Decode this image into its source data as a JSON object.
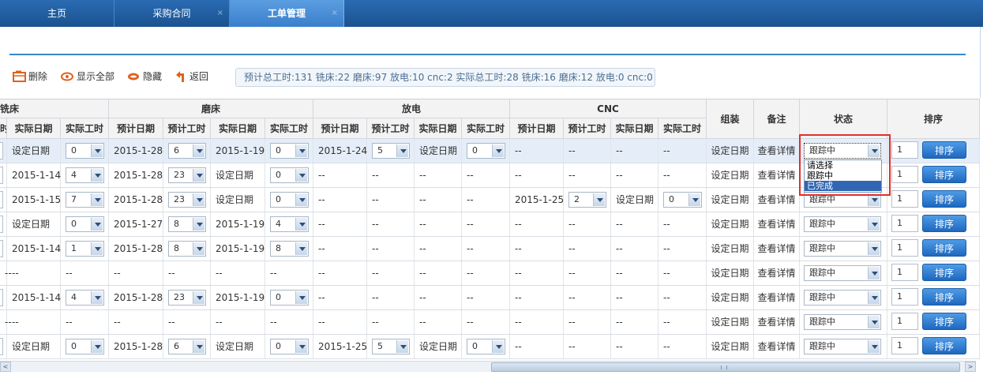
{
  "tabs": [
    {
      "label": "主页",
      "closable": false
    },
    {
      "label": "采购合同",
      "closable": true
    },
    {
      "label": "工单管理",
      "closable": true
    }
  ],
  "close_glyph": "×",
  "toolbar": {
    "delete_label": "删除",
    "show_all_label": "显示全部",
    "hide_label": "隐藏",
    "back_label": "返回",
    "summary": "预计总工时:131 铣床:22 磨床:97 放电:10 cnc:2 实际总工时:28 铣床:16 磨床:12 放电:0 cnc:0"
  },
  "headers": {
    "group_mill": "铣床",
    "group_grind": "磨床",
    "group_edm": "放电",
    "group_cnc": "CNC",
    "assembly": "组装",
    "remark": "备注",
    "status": "状态",
    "sort": "排序",
    "mill_est_hours_cut": "时",
    "actual_date": "实际日期",
    "actual_hours": "实际工时",
    "est_date": "预计日期",
    "est_hours": "预计工时"
  },
  "rows": [
    {
      "c0": "",
      "m_ad": "设定日期",
      "m_ah": "0",
      "g_ed": "2015-1-28",
      "g_eh": "6",
      "g_ad": "2015-1-19",
      "g_ah": "0",
      "e_ed": "2015-1-24",
      "e_eh": "5",
      "e_ad": "设定日期",
      "e_ah": "0",
      "n_ed": "--",
      "n_eh": "--",
      "n_ad": "--",
      "n_ah": "--",
      "assembly": "设定日期",
      "remark": "查看详情",
      "status": "跟踪中",
      "sort": "1",
      "btn": "排序"
    },
    {
      "c0": "",
      "m_ad": "2015-1-14",
      "m_ah": "4",
      "g_ed": "2015-1-28",
      "g_eh": "23",
      "g_ad": "设定日期",
      "g_ah": "0",
      "e_ed": "--",
      "e_eh": "--",
      "e_ad": "--",
      "e_ah": "--",
      "n_ed": "--",
      "n_eh": "--",
      "n_ad": "--",
      "n_ah": "--",
      "assembly": "设定日期",
      "remark": "查看详情",
      "status": "跟踪中",
      "sort": "1",
      "btn": "排序"
    },
    {
      "c0": "",
      "m_ad": "2015-1-15",
      "m_ah": "7",
      "g_ed": "2015-1-28",
      "g_eh": "23",
      "g_ad": "设定日期",
      "g_ah": "0",
      "e_ed": "--",
      "e_eh": "--",
      "e_ad": "--",
      "e_ah": "--",
      "n_ed": "2015-1-25",
      "n_eh": "2",
      "n_ad": "设定日期",
      "n_ah": "0",
      "assembly": "设定日期",
      "remark": "查看详情",
      "status": "跟踪中",
      "sort": "1",
      "btn": "排序"
    },
    {
      "c0": "",
      "m_ad": "设定日期",
      "m_ah": "0",
      "g_ed": "2015-1-27",
      "g_eh": "8",
      "g_ad": "2015-1-19",
      "g_ah": "4",
      "e_ed": "--",
      "e_eh": "--",
      "e_ad": "--",
      "e_ah": "--",
      "n_ed": "--",
      "n_eh": "--",
      "n_ad": "--",
      "n_ah": "--",
      "assembly": "设定日期",
      "remark": "查看详情",
      "status": "跟踪中",
      "sort": "1",
      "btn": "排序"
    },
    {
      "c0": "",
      "m_ad": "2015-1-14",
      "m_ah": "1",
      "g_ed": "2015-1-28",
      "g_eh": "8",
      "g_ad": "2015-1-19",
      "g_ah": "8",
      "e_ed": "--",
      "e_eh": "--",
      "e_ad": "--",
      "e_ah": "--",
      "n_ed": "--",
      "n_eh": "--",
      "n_ad": "--",
      "n_ah": "--",
      "assembly": "设定日期",
      "remark": "查看详情",
      "status": "跟踪中",
      "sort": "1",
      "btn": "排序"
    },
    {
      "c0": "--",
      "m_ad": "--",
      "m_ah": "--",
      "g_ed": "--",
      "g_eh": "--",
      "g_ad": "--",
      "g_ah": "--",
      "e_ed": "--",
      "e_eh": "--",
      "e_ad": "--",
      "e_ah": "--",
      "n_ed": "--",
      "n_eh": "--",
      "n_ad": "--",
      "n_ah": "--",
      "assembly": "设定日期",
      "remark": "查看详情",
      "status": "跟踪中",
      "sort": "1",
      "btn": "排序"
    },
    {
      "c0": "",
      "m_ad": "2015-1-14",
      "m_ah": "4",
      "g_ed": "2015-1-28",
      "g_eh": "23",
      "g_ad": "2015-1-19",
      "g_ah": "0",
      "e_ed": "--",
      "e_eh": "--",
      "e_ad": "--",
      "e_ah": "--",
      "n_ed": "--",
      "n_eh": "--",
      "n_ad": "--",
      "n_ah": "--",
      "assembly": "设定日期",
      "remark": "查看详情",
      "status": "跟踪中",
      "sort": "1",
      "btn": "排序"
    },
    {
      "c0": "--",
      "m_ad": "--",
      "m_ah": "--",
      "g_ed": "--",
      "g_eh": "--",
      "g_ad": "--",
      "g_ah": "--",
      "e_ed": "--",
      "e_eh": "--",
      "e_ad": "--",
      "e_ah": "--",
      "n_ed": "--",
      "n_eh": "--",
      "n_ad": "--",
      "n_ah": "--",
      "assembly": "设定日期",
      "remark": "查看详情",
      "status": "跟踪中",
      "sort": "1",
      "btn": "排序"
    },
    {
      "c0": "",
      "m_ad": "设定日期",
      "m_ah": "0",
      "g_ed": "2015-1-28",
      "g_eh": "6",
      "g_ad": "设定日期",
      "g_ah": "0",
      "e_ed": "2015-1-25",
      "e_eh": "5",
      "e_ad": "设定日期",
      "e_ah": "0",
      "n_ed": "--",
      "n_eh": "--",
      "n_ad": "--",
      "n_ah": "--",
      "assembly": "设定日期",
      "remark": "查看详情",
      "status": "跟踪中",
      "sort": "1",
      "btn": "排序"
    }
  ],
  "dropdown_options": [
    "请选择",
    "跟踪中",
    "已完成"
  ],
  "dropdown_highlighted": "已完成",
  "scroll_arrows": {
    "left": "<",
    "right": ">"
  },
  "colors": {
    "accent": "#1e68bf",
    "highlight_box": "#e0302a",
    "tabbar": "#1a528f"
  }
}
